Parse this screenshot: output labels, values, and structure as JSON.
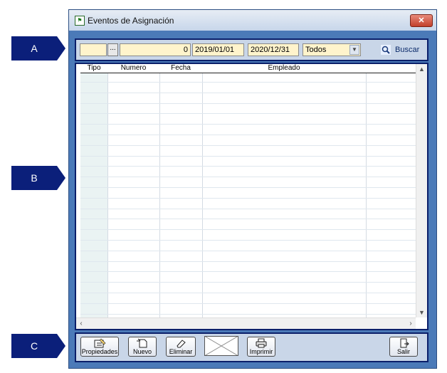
{
  "callouts": [
    "A",
    "B",
    "C"
  ],
  "window": {
    "title": "Eventos de Asignación",
    "close_label": "✕"
  },
  "filter_bar": {
    "field1_value": "",
    "browse_label": "...",
    "number_value": "0",
    "date_from": "2019/01/01",
    "date_to": "2020/12/31",
    "type_select": "Todos",
    "search_label": "Buscar"
  },
  "grid": {
    "columns": [
      "Tipo",
      "Numero",
      "Fecha",
      "Empleado"
    ],
    "rows": []
  },
  "toolbar": {
    "properties_label": "Propiedades",
    "new_label": "Nuevo",
    "delete_label": "Eliminar",
    "print_label": "Imprimir",
    "exit_label": "Salir"
  }
}
